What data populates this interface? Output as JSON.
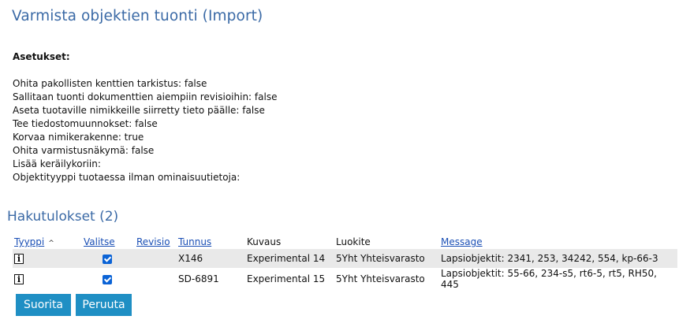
{
  "page": {
    "title": "Varmista objektien tuonti (Import)"
  },
  "settings": {
    "heading": "Asetukset:",
    "items": [
      "Ohita pakollisten kenttien tarkistus: false",
      "Sallitaan tuonti dokumenttien aiempiin revisioihin: false",
      "Aseta tuotaville nimikkeille siirretty tieto päälle: false",
      "Tee tiedostomuunnokset: false",
      "Korvaa nimikerakenne: true",
      "Ohita varmistusnäkymä: false",
      "Lisää keräilykoriin:",
      "Objektityyppi tuotaessa ilman ominaisuutietoja:"
    ]
  },
  "results": {
    "heading": "Hakutulokset (2)",
    "columns": {
      "type": "Tyyppi",
      "select": "Valitse",
      "revision": "Revisio",
      "id": "Tunnus",
      "description": "Kuvaus",
      "classification": "Luokite",
      "message": "Message"
    },
    "rows": [
      {
        "type_icon": "info-icon",
        "selected": true,
        "revision": "",
        "id": "X146",
        "description": "Experimental 14",
        "classification": "5Yht Yhteisvarasto",
        "message": "Lapsiobjektit: 2341, 253, 34242, 554, kp-66-3"
      },
      {
        "type_icon": "info-icon",
        "selected": true,
        "revision": "",
        "id": "SD-6891",
        "description": "Experimental 15",
        "classification": "5Yht Yhteisvarasto",
        "message": "Lapsiobjektit: 55-66, 234-s5, rt6-5, rt5, RH50, 445"
      }
    ]
  },
  "actions": {
    "execute": "Suorita",
    "cancel": "Peruuta"
  },
  "colors": {
    "title": "#3b6aa6",
    "link": "#1a4fb5",
    "button": "#1f8fc4",
    "checkbox": "#0b63d6",
    "row_shade": "#e9e9e9"
  }
}
